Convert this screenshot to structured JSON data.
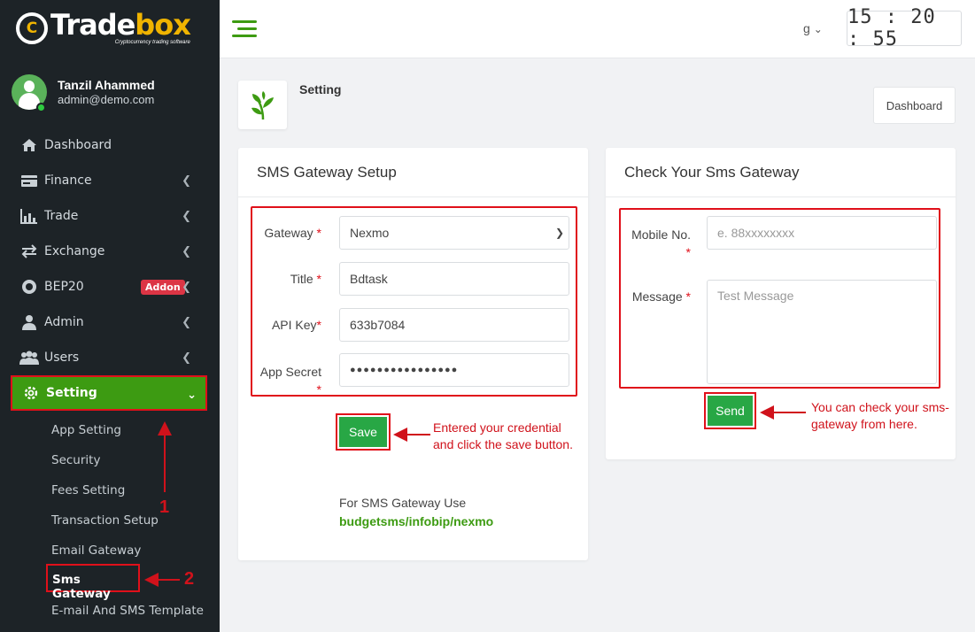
{
  "brand": {
    "name_main": "Trade",
    "name_accent": "box",
    "logo_mark": "C",
    "tagline": "Cryptocurrency trading software"
  },
  "user": {
    "name": "Tanzil Ahammed",
    "email": "admin@demo.com"
  },
  "nav": {
    "dashboard": "Dashboard",
    "finance": "Finance",
    "trade": "Trade",
    "exchange": "Exchange",
    "bep20": "BEP20",
    "addon": "Addon",
    "admin": "Admin",
    "users": "Users",
    "setting": "Setting"
  },
  "submenu": {
    "app_setting": "App Setting",
    "security": "Security",
    "fees_setting": "Fees Setting",
    "transaction_setup": "Transaction Setup",
    "email_gateway": "Email Gateway",
    "sms_gateway": "Sms Gateway",
    "template": "E-mail And SMS Template"
  },
  "topbar": {
    "lang": "g",
    "clock": "15 : 20 : 55"
  },
  "page": {
    "title": "Setting",
    "dashboard_button": "Dashboard"
  },
  "sms_setup": {
    "title": "SMS Gateway Setup",
    "gateway_label": "Gateway",
    "gateway_value": "Nexmo",
    "title_label": "Title",
    "title_value": "Bdtask",
    "api_key_label": "API Key",
    "api_key_value": "633b7084",
    "app_secret_label": "App Secret",
    "app_secret_value": "●●●●●●●●●●●●●●●●",
    "save_label": "Save",
    "use_note": "For SMS Gateway Use",
    "use_providers": "budgetsms/infobip/nexmo"
  },
  "sms_check": {
    "title": "Check Your Sms Gateway",
    "mobile_label": "Mobile No.",
    "mobile_placeholder": "e. 88xxxxxxxx",
    "message_label": "Message",
    "message_placeholder": "Test Message",
    "send_label": "Send"
  },
  "annotations": {
    "save_line1": "Entered your credential",
    "save_line2": "and click the save button.",
    "send_line1": "You can check your sms-",
    "send_line2": "gateway from here.",
    "step1": "1",
    "step2": "2"
  },
  "colors": {
    "sidebar_bg": "#1d2327",
    "accent_green": "#3d9b12",
    "button_green": "#28a745",
    "annotation_red": "#e0101a",
    "brand_yellow": "#f0b400"
  }
}
